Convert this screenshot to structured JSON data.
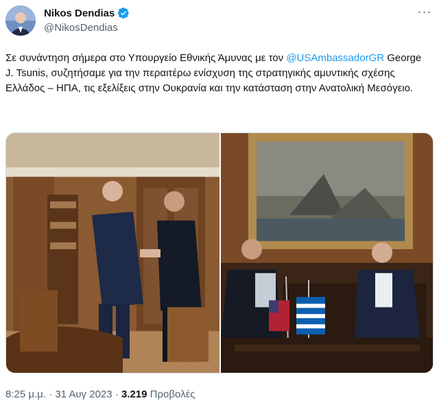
{
  "author": {
    "name": "Nikos Dendias",
    "handle": "@NikosDendias",
    "verified": true,
    "avatar_icon": "profile-avatar"
  },
  "menu": {
    "more_icon": "more-horizontal-icon",
    "label": "···"
  },
  "tweet": {
    "text_part1": "Σε συνάντηση σήμερα στο Υπουργείο Εθνικής Άμυνας με τον ",
    "mention": "@USAmbassadorGR",
    "text_part2": " George J. Tsunis, συζητήσαμε για την περαιτέρω ενίσχυση της στρατηγικής αμυντικής σχέσης Ελλάδος – ΗΠΑ, τις εξελίξεις στην Ουκρανία και την κατάσταση στην Ανατολική Μεσόγειο."
  },
  "media": {
    "photos": [
      {
        "description_icon": "photo-handshake"
      },
      {
        "description_icon": "photo-meeting-seated"
      }
    ]
  },
  "meta": {
    "time": "8:25 μ.μ.",
    "separator": " · ",
    "date": "31 Αυγ 2023",
    "views_count": "3.219",
    "views_label": "Προβολές"
  },
  "colors": {
    "link": "#1d9bf0",
    "secondary": "#536471",
    "text": "#0f1419"
  }
}
